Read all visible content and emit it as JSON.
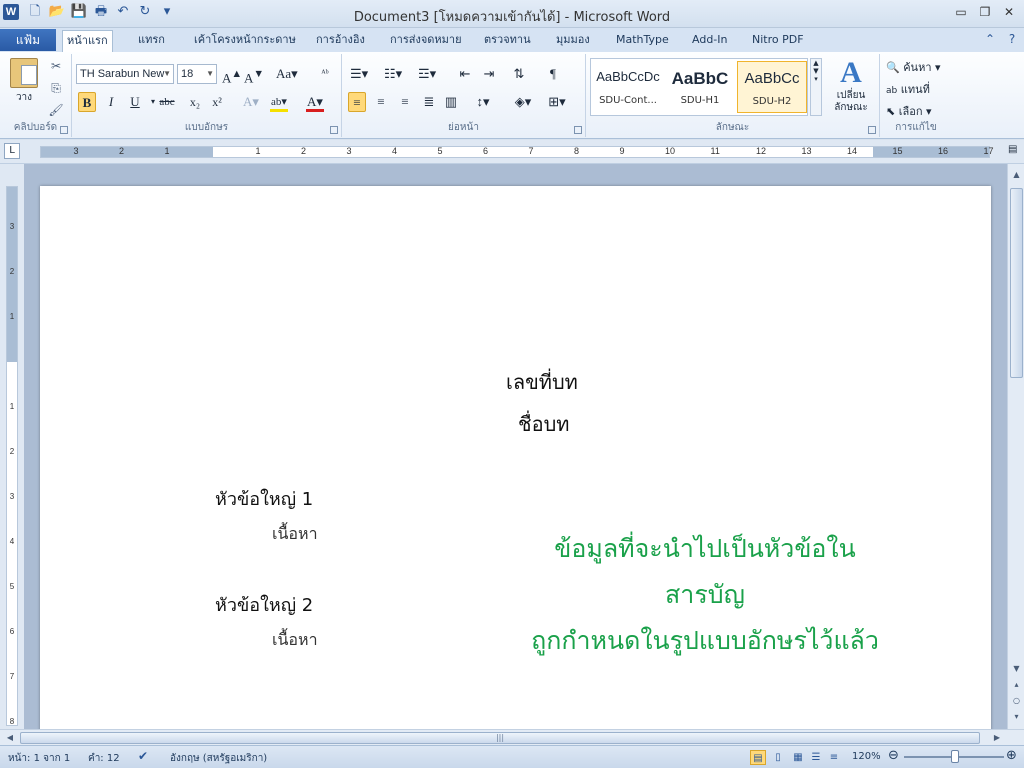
{
  "window": {
    "title": "Document3 [โหมดความเข้ากันได้] - Microsoft Word",
    "app_icon": "W"
  },
  "qat": [
    "new-doc-icon",
    "open-icon",
    "save-icon",
    "print-icon",
    "undo-icon",
    "redo-icon",
    "customize-icon"
  ],
  "tabs": {
    "file": "แฟ้ม",
    "items": [
      "หน้าแรก",
      "แทรก",
      "เค้าโครงหน้ากระดาษ",
      "การอ้างอิง",
      "การส่งจดหมาย",
      "ตรวจทาน",
      "มุมมอง",
      "MathType",
      "Add-In",
      "Nitro PDF"
    ]
  },
  "ribbon": {
    "clipboard": {
      "paste": "วาง",
      "label": "คลิปบอร์ด"
    },
    "font": {
      "name": "TH Sarabun New",
      "size": "18",
      "label": "แบบอักษร"
    },
    "paragraph": {
      "label": "ย่อหน้า"
    },
    "styles": {
      "label": "ลักษณะ",
      "items": [
        {
          "sample": "AaBbCcDc",
          "name": "SDU-Cont..."
        },
        {
          "sample": "AaBbC",
          "name": "SDU-H1"
        },
        {
          "sample": "AaBbCc",
          "name": "SDU-H2"
        }
      ],
      "change": "เปลี่ยน\nลักษณะ"
    },
    "editing": {
      "label": "การแก้ไข",
      "find": "ค้นหา",
      "replace": "แทนที่",
      "select": "เลือก"
    }
  },
  "ruler": {
    "h_ticks": [
      "3",
      "2",
      "1",
      "1",
      "2",
      "3",
      "4",
      "5",
      "6",
      "7",
      "8",
      "9",
      "10",
      "11",
      "12",
      "13",
      "14",
      "15",
      "16",
      "17"
    ],
    "v_ticks": [
      "3",
      "2",
      "1",
      "1",
      "2",
      "3",
      "4",
      "5",
      "6",
      "7",
      "8"
    ]
  },
  "document": {
    "chapter_number": "เลขที่บท",
    "chapter_title": "ชื่อบท",
    "heading1": "หัวข้อใหญ่ 1",
    "body1": "เนื้อหา",
    "heading2": "หัวข้อใหญ่ 2",
    "body2": "เนื้อหา",
    "note_line1": "ข้อมูลที่จะนำไปเป็นหัวข้อในสารบัญ",
    "note_line2": "ถูกกำหนดในรูปแบบอักษรไว้แล้ว"
  },
  "status": {
    "page": "หน้า: 1 จาก 1",
    "words": "คำ: 12",
    "language": "อังกฤษ (สหรัฐอเมริกา)",
    "zoom": "120%"
  },
  "colors": {
    "note_text": "#1aa14a",
    "file_tab": "#2a5aa5"
  }
}
